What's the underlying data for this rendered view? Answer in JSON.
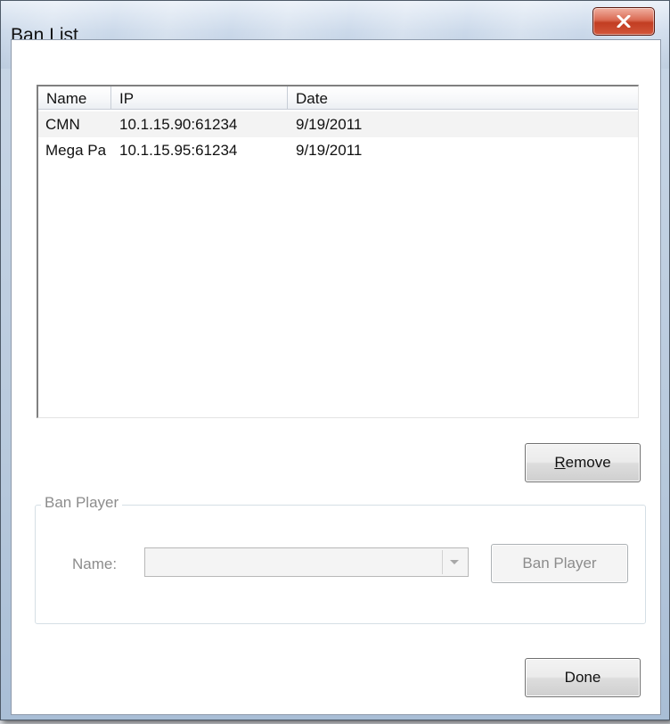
{
  "window": {
    "title": "Ban List"
  },
  "list": {
    "columns": [
      "Name",
      "IP",
      "Date"
    ],
    "rows": [
      {
        "name": "CMN",
        "ip": "10.1.15.90:61234",
        "date": "9/19/2011"
      },
      {
        "name": "Mega Pa",
        "ip": "10.1.15.95:61234",
        "date": "9/19/2011"
      }
    ]
  },
  "remove_button": {
    "label_accel": "R",
    "label_rest": "emove"
  },
  "ban_player": {
    "group_label": "Ban Player",
    "name_label": "Name:",
    "name_value": "",
    "button_label": "Ban Player"
  },
  "done_button": {
    "label": "Done"
  },
  "icons": {
    "close": "close-icon",
    "dropdown": "chevron-down-icon"
  },
  "colors": {
    "close_button": "#c8432a",
    "disabled_text": "#8c8c8c"
  }
}
